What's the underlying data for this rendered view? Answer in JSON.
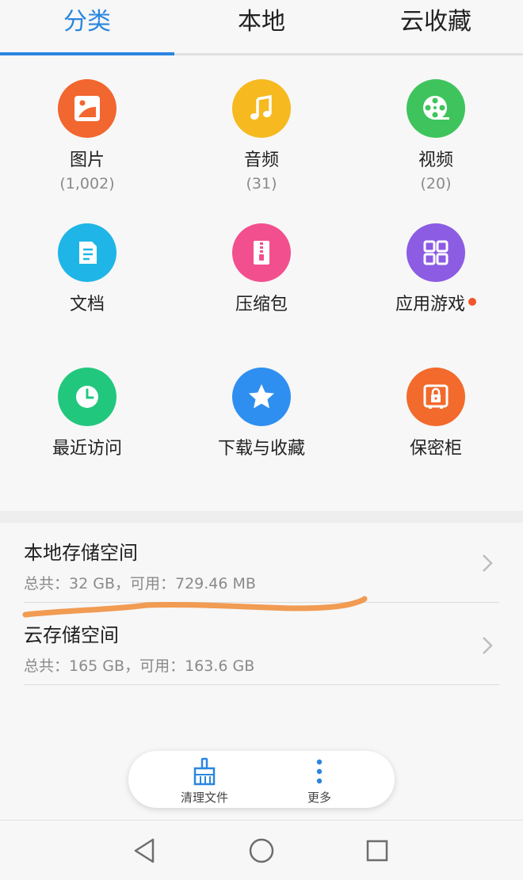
{
  "tabs": [
    {
      "label": "分类",
      "active": true
    },
    {
      "label": "本地",
      "active": false
    },
    {
      "label": "云收藏",
      "active": false
    }
  ],
  "categories": [
    {
      "label": "图片",
      "count": "(1,002)",
      "color": "#f2662f",
      "icon": "image-icon"
    },
    {
      "label": "音频",
      "count": "(31)",
      "color": "#f6b91f",
      "icon": "music-note-icon"
    },
    {
      "label": "视频",
      "count": "(20)",
      "color": "#3fc45d",
      "icon": "film-reel-icon"
    },
    {
      "label": "文档",
      "count": "",
      "color": "#1fb5e6",
      "icon": "document-icon"
    },
    {
      "label": "压缩包",
      "count": "",
      "color": "#f24f8e",
      "icon": "zip-icon"
    },
    {
      "label": "应用游戏",
      "count": "",
      "color": "#8c5ce3",
      "icon": "apps-grid-icon",
      "badge": true
    },
    {
      "label": "最近访问",
      "count": "",
      "color": "#22c77e",
      "icon": "clock-icon"
    },
    {
      "label": "下载与收藏",
      "count": "",
      "color": "#2f8ff0",
      "icon": "star-icon"
    },
    {
      "label": "保密柜",
      "count": "",
      "color": "#f26a2c",
      "icon": "safe-icon"
    }
  ],
  "storage": {
    "local": {
      "title": "本地存储空间",
      "detail": "总共：32 GB，可用：729.46 MB"
    },
    "cloud": {
      "title": "云存储空间",
      "detail": "总共：165 GB，可用：163.6 GB"
    }
  },
  "actions": {
    "clean": {
      "label": "清理文件",
      "icon": "broom-icon"
    },
    "more": {
      "label": "更多",
      "icon": "more-vertical-icon"
    }
  },
  "navigation": {
    "back": "back-triangle-icon",
    "home": "home-circle-icon",
    "recents": "recents-square-icon"
  },
  "colors": {
    "accent": "#2a86e0",
    "annotation_stroke": "#f09040",
    "badge": "#f2562b"
  }
}
